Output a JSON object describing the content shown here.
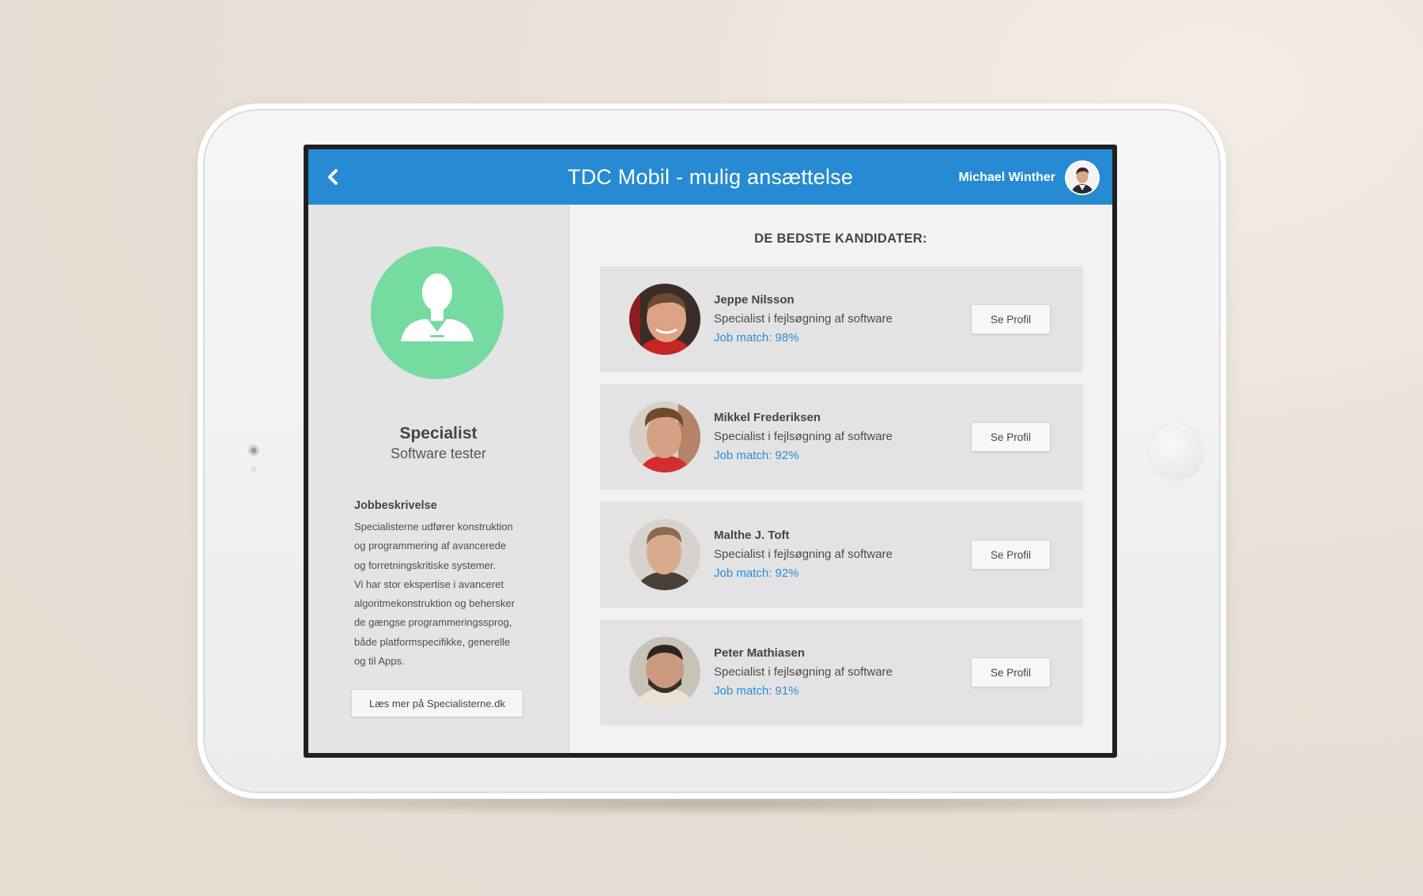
{
  "header": {
    "title": "TDC Mobil - mulig ansættelse",
    "user_name": "Michael Winther"
  },
  "sidebar": {
    "role_title": "Specialist",
    "role_subtitle": "Software tester",
    "description_heading": "Jobbeskrivelse",
    "description_lines": [
      "Specialisterne udfører konstruktion",
      "og programmering af avancerede",
      "og forretningskritiske systemer.",
      "Vi har stor ekspertise i avanceret",
      "algoritmekonstruktion og behersker",
      "de gængse programmeringssprog,",
      "både platformspecifikke, generelle",
      "og til Apps."
    ],
    "read_more_label": "Læs mer på Specialisterne.dk"
  },
  "main": {
    "heading": "DE BEDSTE KANDIDATER:",
    "candidates": [
      {
        "name": "Jeppe Nilsson",
        "role": "Specialist i fejlsøgning af software",
        "match": "Job match: 98%",
        "button": "Se Profil"
      },
      {
        "name": "Mikkel Frederiksen",
        "role": "Specialist i fejlsøgning af software",
        "match": "Job match: 92%",
        "button": "Se Profil"
      },
      {
        "name": "Malthe J. Toft",
        "role": "Specialist i fejlsøgning af software",
        "match": "Job match: 92%",
        "button": "Se Profil"
      },
      {
        "name": "Peter Mathiasen",
        "role": "Specialist i fejlsøgning af software",
        "match": "Job match: 91%",
        "button": "Se Profil"
      }
    ]
  },
  "icons": {
    "back": "chevron-left-icon",
    "role_avatar": "person-silhouette-icon"
  },
  "colors": {
    "topbar": "#268bd2",
    "role_avatar_bg": "#76dba0",
    "match_text": "#2c8cd6",
    "sidebar_bg": "#e4e4e4",
    "card_bg": "#e3e3e3"
  }
}
